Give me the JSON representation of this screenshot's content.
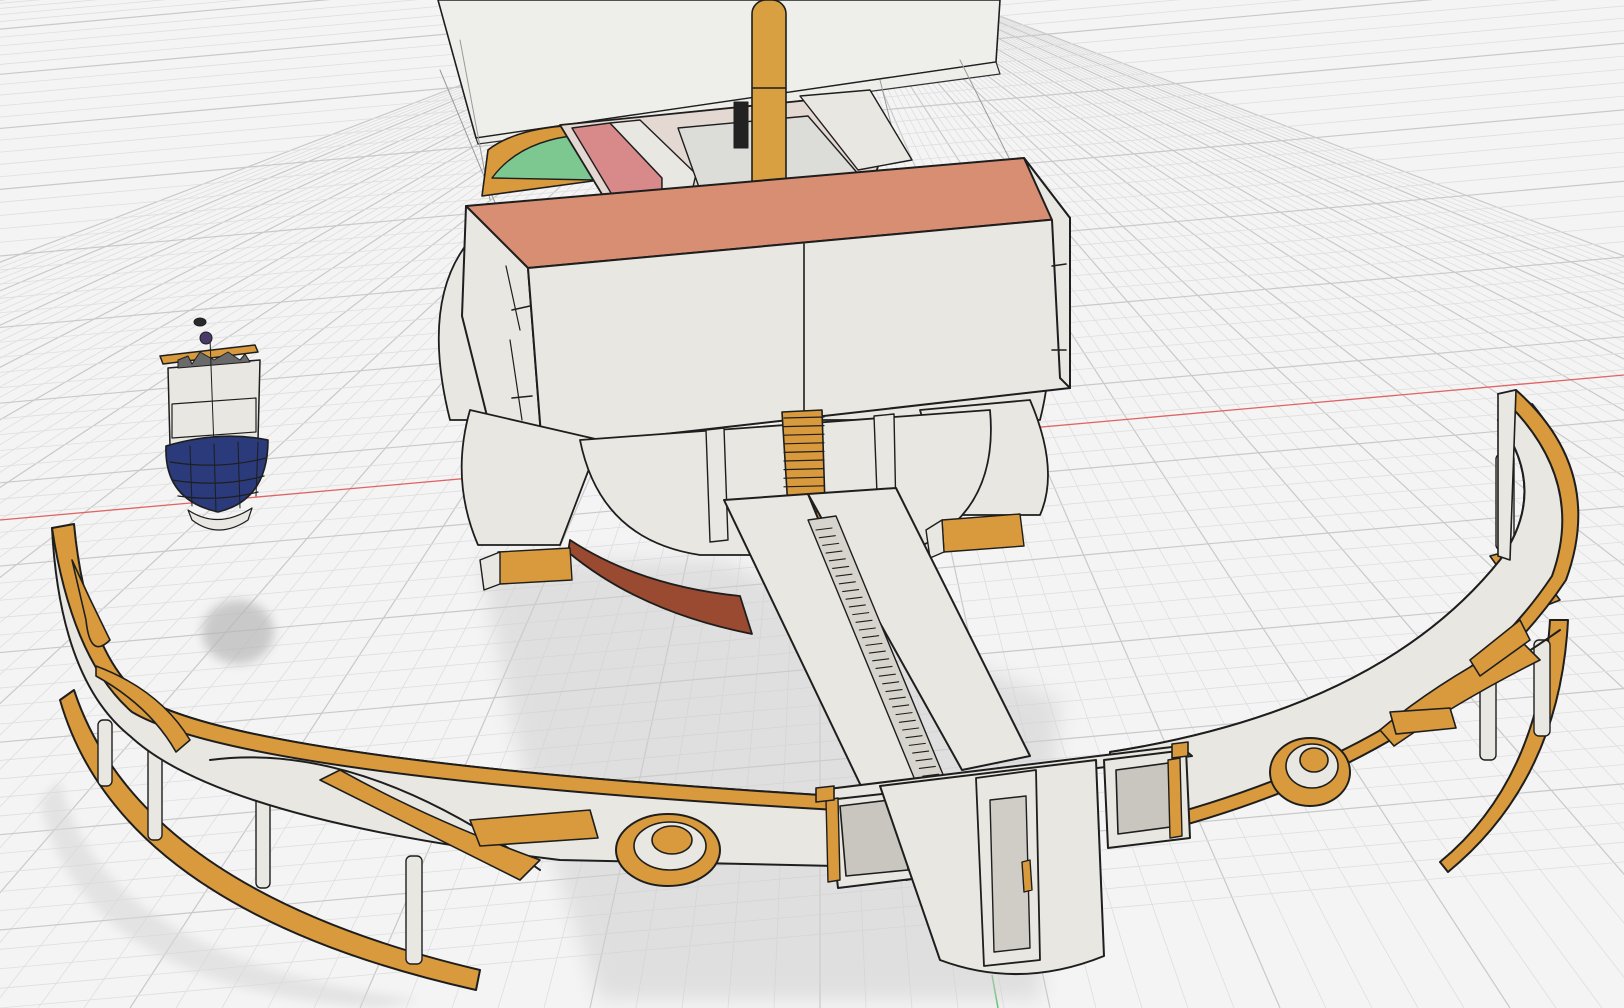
{
  "viewport": {
    "label": "3D model viewport",
    "background": "#f4f4f4",
    "grid_minor_color": "#dedede",
    "grid_major_color": "#c9c9c9",
    "x_axis_color": "#e06464",
    "z_axis_color": "#5ac46a"
  },
  "model": {
    "hull_color": "#e9e7e1",
    "trim_color": "#d89a3c",
    "outline_color": "#1e1e1e",
    "deck_color": "#d88e72",
    "sail_color": "#eeeeea",
    "mast_color": "#d8a040",
    "keel_color": "#9a4a30",
    "cabin_roof_color": "#e3d8d2",
    "cabin_accent_color": "#d88a8a",
    "dome_color": "#2a3a7a",
    "window_color": "#7cc890"
  }
}
